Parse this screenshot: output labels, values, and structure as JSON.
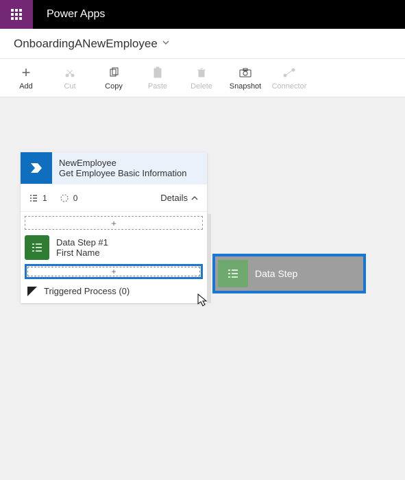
{
  "header": {
    "app_title": "Power Apps"
  },
  "subheader": {
    "flow_name": "OnboardingANewEmployee"
  },
  "toolbar": {
    "add": "Add",
    "cut": "Cut",
    "copy": "Copy",
    "paste": "Paste",
    "delete": "Delete",
    "snapshot": "Snapshot",
    "connector": "Connector"
  },
  "card": {
    "title": "NewEmployee",
    "subtitle": "Get Employee Basic Information",
    "count1": "1",
    "count2": "0",
    "details_label": "Details",
    "add_plus1": "+",
    "add_plus2": "+",
    "step_title": "Data Step #1",
    "step_sub": "First Name",
    "triggered": "Triggered Process (0)"
  },
  "drag": {
    "label": "Data Step"
  }
}
